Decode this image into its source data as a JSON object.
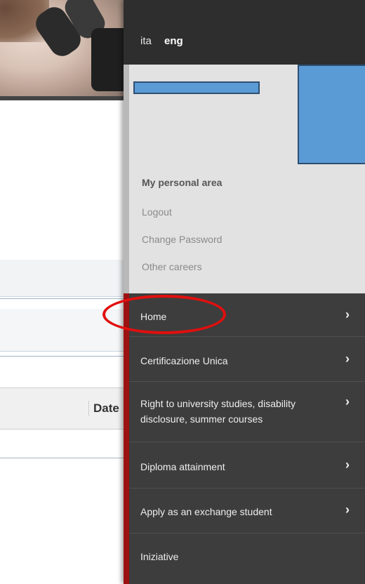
{
  "background": {
    "table_header_date": "Date"
  },
  "language": {
    "ita": "ita",
    "eng": "eng"
  },
  "personal_area": {
    "title": "My personal area",
    "links": [
      "Logout",
      "Change Password",
      "Other careers"
    ]
  },
  "menu": {
    "items": [
      {
        "label": "Home",
        "icon": "chevron-right-icon"
      },
      {
        "label": "Certificazione Unica",
        "icon": "chevron-right-icon"
      },
      {
        "label": "Right to university studies, disability disclosure, summer courses",
        "icon": "chevron-right-icon"
      },
      {
        "label": "Diploma attainment",
        "icon": "chevron-right-icon"
      },
      {
        "label": "Apply as an exchange student",
        "icon": "chevron-right-icon"
      },
      {
        "label": "Iniziative"
      }
    ]
  },
  "colors": {
    "menu_accent": "#9c1111",
    "highlight_circle": "#e10f0f",
    "redaction": "#5b9bd5"
  }
}
